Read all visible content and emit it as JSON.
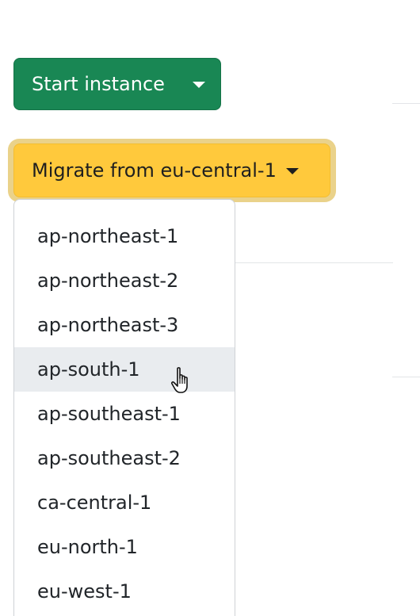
{
  "buttons": {
    "start": {
      "label": "Start instance",
      "color": "#198754"
    },
    "migrate": {
      "label": "Migrate from eu-central-1",
      "color": "#ffc93c"
    }
  },
  "menu": {
    "items": [
      {
        "label": "ap-northeast-1"
      },
      {
        "label": "ap-northeast-2"
      },
      {
        "label": "ap-northeast-3"
      },
      {
        "label": "ap-south-1",
        "state": "hovered"
      },
      {
        "label": "ap-southeast-1"
      },
      {
        "label": "ap-southeast-2"
      },
      {
        "label": "ca-central-1"
      },
      {
        "label": "eu-north-1"
      },
      {
        "label": "eu-west-1"
      }
    ]
  },
  "icons": {
    "caret": "chevron-down-icon",
    "cursor": "hand-pointer-icon"
  }
}
